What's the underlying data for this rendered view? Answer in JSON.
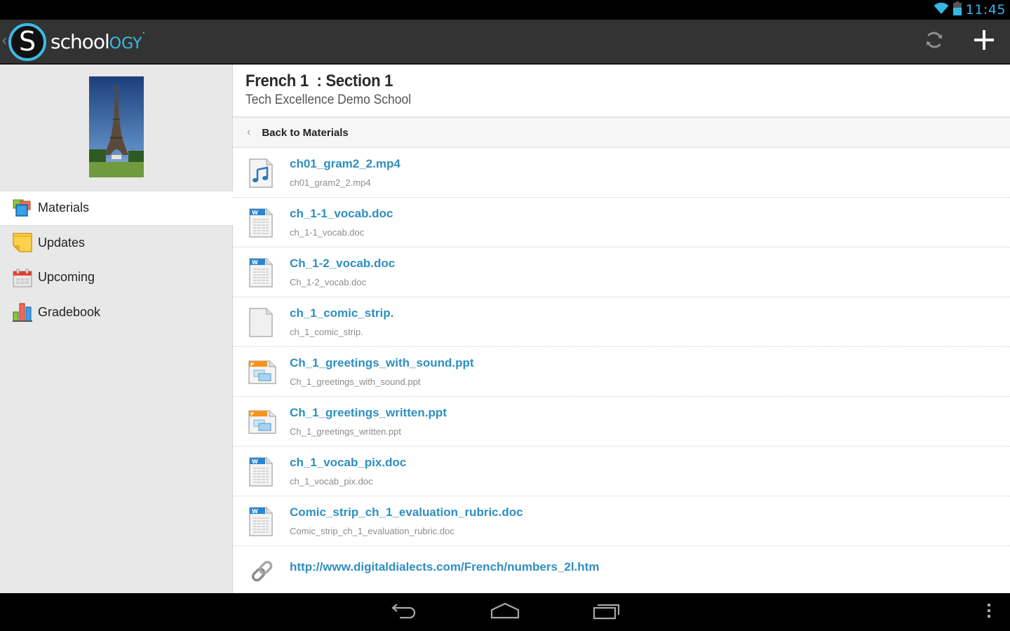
{
  "status_bar": {
    "time": "11:45",
    "icons": [
      "wifi-icon",
      "battery-icon"
    ]
  },
  "action_bar": {
    "app_name_prefix": "schoo",
    "app_name_mid": "l",
    "app_name_suffix": "OGY",
    "logo_letter": "S",
    "up_caret": "‹",
    "actions": [
      {
        "name": "refresh",
        "icon": "refresh-icon"
      },
      {
        "name": "add",
        "icon": "plus-icon"
      }
    ]
  },
  "sidebar": {
    "course_image": "eiffel-tower-photo",
    "items": [
      {
        "label": "Materials",
        "icon": "materials-icon",
        "active": true
      },
      {
        "label": "Updates",
        "icon": "updates-icon",
        "active": false
      },
      {
        "label": "Upcoming",
        "icon": "calendar-icon",
        "active": false
      },
      {
        "label": "Gradebook",
        "icon": "gradebook-icon",
        "active": false
      }
    ]
  },
  "main": {
    "course_title": "French 1  : Section 1",
    "school_name": "Tech Excellence Demo School",
    "back_label": "Back to Materials",
    "back_caret": "‹",
    "files": [
      {
        "title": "ch01_gram2_2.mp4",
        "subtitle": "ch01_gram2_2.mp4",
        "type": "audio"
      },
      {
        "title": "ch_1-1_vocab.doc",
        "subtitle": "ch_1-1_vocab.doc",
        "type": "word"
      },
      {
        "title": "Ch_1-2_vocab.doc",
        "subtitle": "Ch_1-2_vocab.doc",
        "type": "word"
      },
      {
        "title": "ch_1_comic_strip.",
        "subtitle": "ch_1_comic_strip.",
        "type": "generic"
      },
      {
        "title": "Ch_1_greetings_with_sound.ppt",
        "subtitle": "Ch_1_greetings_with_sound.ppt",
        "type": "powerpoint"
      },
      {
        "title": "Ch_1_greetings_written.ppt",
        "subtitle": "Ch_1_greetings_written.ppt",
        "type": "powerpoint"
      },
      {
        "title": "ch_1_vocab_pix.doc",
        "subtitle": "ch_1_vocab_pix.doc",
        "type": "word"
      },
      {
        "title": "Comic_strip_ch_1_evaluation_rubric.doc",
        "subtitle": "Comic_strip_ch_1_evaluation_rubric.doc",
        "type": "word"
      },
      {
        "title": "http://www.digitaldialects.com/French/numbers_2l.htm",
        "subtitle": "",
        "type": "link"
      }
    ]
  },
  "system_nav": {
    "buttons": [
      "back-icon",
      "home-icon",
      "recent-apps-icon",
      "overflow-menu-icon"
    ]
  },
  "colors": {
    "accent": "#33b5e5",
    "brand_blue": "#3cbbe6",
    "link_blue": "#2e8fbf",
    "action_bar": "#333333",
    "sidebar_bg": "#e8e8e8"
  }
}
